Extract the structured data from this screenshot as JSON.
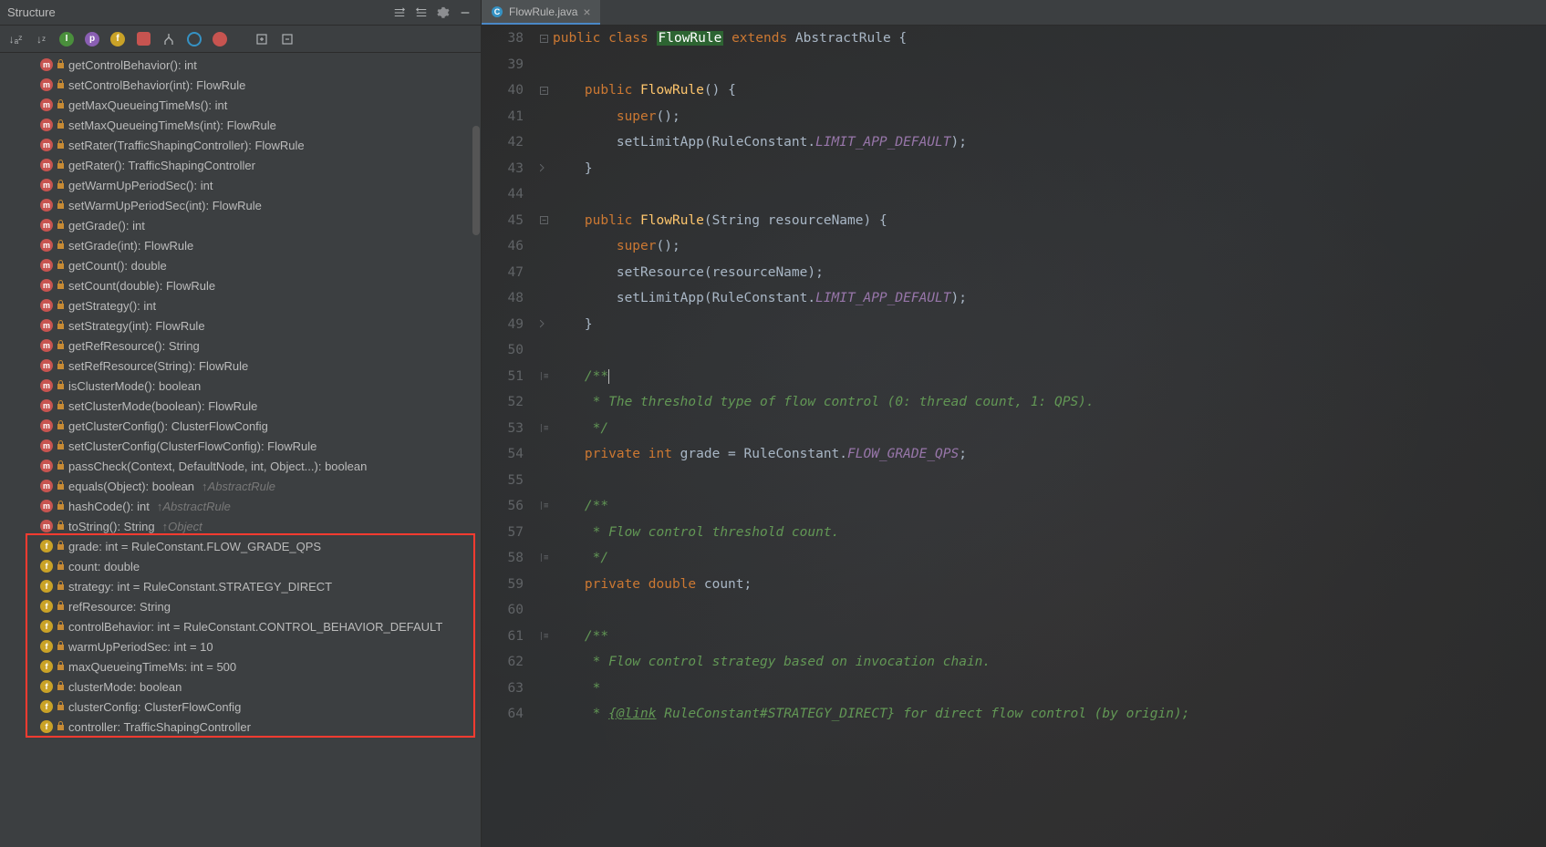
{
  "panel": {
    "title": "Structure",
    "toolbarIcons": [
      "sort-alpha-asc",
      "sort-alpha-desc",
      "interface",
      "property",
      "field",
      "local",
      "branch",
      "circle-blue",
      "circle-red",
      "expand",
      "collapse"
    ],
    "headerActions": [
      "scroll-from-icon",
      "scroll-to-icon",
      "settings-icon",
      "minimize-icon"
    ]
  },
  "members": [
    {
      "kind": "m",
      "label": "getControlBehavior(): int"
    },
    {
      "kind": "m",
      "label": "setControlBehavior(int): FlowRule"
    },
    {
      "kind": "m",
      "label": "getMaxQueueingTimeMs(): int"
    },
    {
      "kind": "m",
      "label": "setMaxQueueingTimeMs(int): FlowRule"
    },
    {
      "kind": "m",
      "label": "setRater(TrafficShapingController): FlowRule"
    },
    {
      "kind": "m",
      "label": "getRater(): TrafficShapingController"
    },
    {
      "kind": "m",
      "label": "getWarmUpPeriodSec(): int"
    },
    {
      "kind": "m",
      "label": "setWarmUpPeriodSec(int): FlowRule"
    },
    {
      "kind": "m",
      "label": "getGrade(): int"
    },
    {
      "kind": "m",
      "label": "setGrade(int): FlowRule"
    },
    {
      "kind": "m",
      "label": "getCount(): double"
    },
    {
      "kind": "m",
      "label": "setCount(double): FlowRule"
    },
    {
      "kind": "m",
      "label": "getStrategy(): int"
    },
    {
      "kind": "m",
      "label": "setStrategy(int): FlowRule"
    },
    {
      "kind": "m",
      "label": "getRefResource(): String"
    },
    {
      "kind": "m",
      "label": "setRefResource(String): FlowRule"
    },
    {
      "kind": "m",
      "label": "isClusterMode(): boolean"
    },
    {
      "kind": "m",
      "label": "setClusterMode(boolean): FlowRule"
    },
    {
      "kind": "m",
      "label": "getClusterConfig(): ClusterFlowConfig"
    },
    {
      "kind": "m",
      "label": "setClusterConfig(ClusterFlowConfig): FlowRule"
    },
    {
      "kind": "m",
      "label": "passCheck(Context, DefaultNode, int, Object...): boolean"
    },
    {
      "kind": "m",
      "label": "equals(Object): boolean",
      "inherited": "↑AbstractRule"
    },
    {
      "kind": "m",
      "label": "hashCode(): int",
      "inherited": "↑AbstractRule"
    },
    {
      "kind": "m",
      "label": "toString(): String",
      "inherited": "↑Object"
    },
    {
      "kind": "f",
      "label": "grade: int = RuleConstant.FLOW_GRADE_QPS"
    },
    {
      "kind": "f",
      "label": "count: double"
    },
    {
      "kind": "f",
      "label": "strategy: int = RuleConstant.STRATEGY_DIRECT"
    },
    {
      "kind": "f",
      "label": "refResource: String"
    },
    {
      "kind": "f",
      "label": "controlBehavior: int = RuleConstant.CONTROL_BEHAVIOR_DEFAULT"
    },
    {
      "kind": "f",
      "label": "warmUpPeriodSec: int = 10"
    },
    {
      "kind": "f",
      "label": "maxQueueingTimeMs: int = 500"
    },
    {
      "kind": "f",
      "label": "clusterMode: boolean"
    },
    {
      "kind": "f",
      "label": "clusterConfig: ClusterFlowConfig"
    },
    {
      "kind": "f",
      "label": "controller: TrafficShapingController"
    }
  ],
  "highlightStart": 24,
  "highlightEnd": 33,
  "tab": {
    "filename": "FlowRule.java"
  },
  "code": {
    "startLine": 38,
    "lines": [
      {
        "n": 38,
        "fold": "-",
        "tokens": [
          {
            "t": "kw",
            "v": "public class "
          },
          {
            "t": "cls-highlight",
            "v": "FlowRule"
          },
          {
            "t": "cls",
            "v": " "
          },
          {
            "t": "kw",
            "v": "extends"
          },
          {
            "t": "cls",
            "v": " AbstractRule "
          },
          {
            "t": "punct",
            "v": "{"
          }
        ]
      },
      {
        "n": 39,
        "tokens": []
      },
      {
        "n": 40,
        "fold": "-",
        "tokens": [
          {
            "t": "indent",
            "v": "    "
          },
          {
            "t": "kw",
            "v": "public"
          },
          {
            "t": "txt",
            "v": " "
          },
          {
            "t": "mtd",
            "v": "FlowRule"
          },
          {
            "t": "punct",
            "v": "() {"
          }
        ]
      },
      {
        "n": 41,
        "tokens": [
          {
            "t": "indent",
            "v": "        "
          },
          {
            "t": "kw",
            "v": "super"
          },
          {
            "t": "punct",
            "v": "();"
          }
        ]
      },
      {
        "n": 42,
        "tokens": [
          {
            "t": "indent",
            "v": "        "
          },
          {
            "t": "txt",
            "v": "setLimitApp(RuleConstant."
          },
          {
            "t": "const",
            "v": "LIMIT_APP_DEFAULT"
          },
          {
            "t": "punct",
            "v": ");"
          }
        ]
      },
      {
        "n": 43,
        "fold": "+",
        "tokens": [
          {
            "t": "indent",
            "v": "    "
          },
          {
            "t": "punct",
            "v": "}"
          }
        ]
      },
      {
        "n": 44,
        "tokens": []
      },
      {
        "n": 45,
        "fold": "-",
        "tokens": [
          {
            "t": "indent",
            "v": "    "
          },
          {
            "t": "kw",
            "v": "public"
          },
          {
            "t": "txt",
            "v": " "
          },
          {
            "t": "mtd",
            "v": "FlowRule"
          },
          {
            "t": "punct",
            "v": "("
          },
          {
            "t": "txt",
            "v": "String resourceName"
          },
          {
            "t": "punct",
            "v": ") {"
          }
        ]
      },
      {
        "n": 46,
        "tokens": [
          {
            "t": "indent",
            "v": "        "
          },
          {
            "t": "kw",
            "v": "super"
          },
          {
            "t": "punct",
            "v": "();"
          }
        ]
      },
      {
        "n": 47,
        "tokens": [
          {
            "t": "indent",
            "v": "        "
          },
          {
            "t": "txt",
            "v": "setResource(resourceName);"
          }
        ]
      },
      {
        "n": 48,
        "tokens": [
          {
            "t": "indent",
            "v": "        "
          },
          {
            "t": "txt",
            "v": "setLimitApp(RuleConstant."
          },
          {
            "t": "const",
            "v": "LIMIT_APP_DEFAULT"
          },
          {
            "t": "punct",
            "v": ");"
          }
        ]
      },
      {
        "n": 49,
        "fold": "+",
        "tokens": [
          {
            "t": "indent",
            "v": "    "
          },
          {
            "t": "punct",
            "v": "}"
          }
        ]
      },
      {
        "n": 50,
        "tokens": []
      },
      {
        "n": 51,
        "fold": "/*",
        "tokens": [
          {
            "t": "indent",
            "v": "    "
          },
          {
            "t": "cmt",
            "v": "/**"
          },
          {
            "t": "caret",
            "v": ""
          }
        ]
      },
      {
        "n": 52,
        "tokens": [
          {
            "t": "indent",
            "v": "     "
          },
          {
            "t": "cmt",
            "v": "* The threshold type of flow control (0: thread count, 1: QPS)."
          }
        ]
      },
      {
        "n": 53,
        "fold": "*/",
        "tokens": [
          {
            "t": "indent",
            "v": "     "
          },
          {
            "t": "cmt",
            "v": "*/"
          }
        ]
      },
      {
        "n": 54,
        "tokens": [
          {
            "t": "indent",
            "v": "    "
          },
          {
            "t": "kw",
            "v": "private int"
          },
          {
            "t": "txt",
            "v": " grade = RuleConstant."
          },
          {
            "t": "const",
            "v": "FLOW_GRADE_QPS"
          },
          {
            "t": "punct",
            "v": ";"
          }
        ]
      },
      {
        "n": 55,
        "tokens": []
      },
      {
        "n": 56,
        "fold": "/*",
        "tokens": [
          {
            "t": "indent",
            "v": "    "
          },
          {
            "t": "cmt",
            "v": "/**"
          }
        ]
      },
      {
        "n": 57,
        "tokens": [
          {
            "t": "indent",
            "v": "     "
          },
          {
            "t": "cmt",
            "v": "* Flow control threshold count."
          }
        ]
      },
      {
        "n": 58,
        "fold": "*/",
        "tokens": [
          {
            "t": "indent",
            "v": "     "
          },
          {
            "t": "cmt",
            "v": "*/"
          }
        ]
      },
      {
        "n": 59,
        "tokens": [
          {
            "t": "indent",
            "v": "    "
          },
          {
            "t": "kw",
            "v": "private double"
          },
          {
            "t": "txt",
            "v": " count"
          },
          {
            "t": "punct",
            "v": ";"
          }
        ]
      },
      {
        "n": 60,
        "tokens": []
      },
      {
        "n": 61,
        "fold": "/*",
        "tokens": [
          {
            "t": "indent",
            "v": "    "
          },
          {
            "t": "cmt",
            "v": "/**"
          }
        ]
      },
      {
        "n": 62,
        "tokens": [
          {
            "t": "indent",
            "v": "     "
          },
          {
            "t": "cmt",
            "v": "* Flow control strategy based on invocation chain."
          }
        ]
      },
      {
        "n": 63,
        "tokens": [
          {
            "t": "indent",
            "v": "     "
          },
          {
            "t": "cmt",
            "v": "*"
          }
        ]
      },
      {
        "n": 64,
        "tokens": [
          {
            "t": "indent",
            "v": "     "
          },
          {
            "t": "cmt",
            "v": "* "
          },
          {
            "t": "cmt-tag",
            "v": "{@link"
          },
          {
            "t": "cmt",
            "v": " RuleConstant#STRATEGY_DIRECT} for direct flow control (by origin);"
          }
        ]
      }
    ]
  }
}
